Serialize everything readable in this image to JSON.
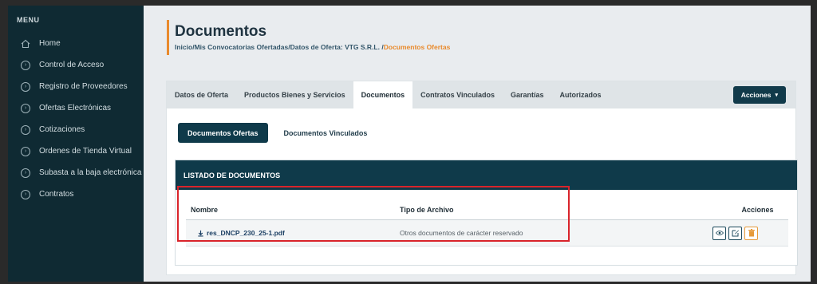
{
  "sidebar": {
    "menu_title": "MENU",
    "items": [
      {
        "label": "Home",
        "icon": "home-icon"
      },
      {
        "label": "Control de Acceso",
        "icon": "circle-chevron-icon"
      },
      {
        "label": "Registro de Proveedores",
        "icon": "circle-chevron-icon"
      },
      {
        "label": "Ofertas Electrónicas",
        "icon": "circle-chevron-icon"
      },
      {
        "label": "Cotizaciones",
        "icon": "circle-chevron-icon"
      },
      {
        "label": "Ordenes de Tienda Virtual",
        "icon": "circle-chevron-icon"
      },
      {
        "label": "Subasta a la baja electrónica",
        "icon": "circle-chevron-icon"
      },
      {
        "label": "Contratos",
        "icon": "circle-chevron-icon"
      }
    ]
  },
  "header": {
    "title": "Documentos",
    "breadcrumb": {
      "items": [
        "Inicio",
        "Mis Convocatorias Ofertadas",
        "Datos de Oferta: VTG S.R.L. "
      ],
      "active": "Documentos Ofertas"
    }
  },
  "tabs": [
    {
      "label": "Datos de Oferta",
      "active": false
    },
    {
      "label": "Productos Bienes y Servicios",
      "active": false
    },
    {
      "label": "Documentos",
      "active": true
    },
    {
      "label": "Contratos Vinculados",
      "active": false
    },
    {
      "label": "Garantías",
      "active": false
    },
    {
      "label": "Autorizados",
      "active": false
    }
  ],
  "actions_button": "Acciones",
  "subtabs": [
    {
      "label": "Documentos Ofertas",
      "active": true
    },
    {
      "label": "Documentos Vinculados",
      "active": false
    }
  ],
  "listing": {
    "title": "LISTADO DE DOCUMENTOS",
    "columns": {
      "name": "Nombre",
      "type": "Tipo de Archivo",
      "actions": "Acciones"
    },
    "rows": [
      {
        "name": "res_DNCP_230_25-1.pdf",
        "type": "Otros documentos de carácter reservado"
      }
    ]
  },
  "colors": {
    "sidebar_bg": "#0f2a33",
    "primary": "#0f3a4a",
    "accent": "#e98a2c",
    "highlight": "#d9242b"
  }
}
